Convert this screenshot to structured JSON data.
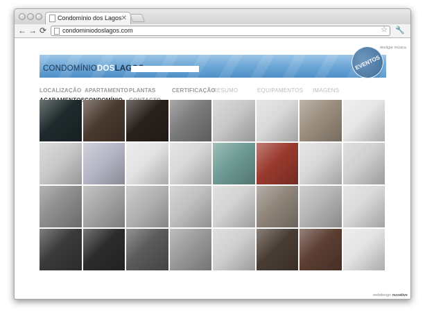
{
  "browser": {
    "tab_title": "Condomínio dos Lagos",
    "tab_close": "✕",
    "url": "condominiodoslagos.com",
    "back": "←",
    "forward": "→",
    "reload": "⟳",
    "star": "☆",
    "wrench": "🔧"
  },
  "page": {
    "music_link": "desligar música",
    "brand": {
      "part1": "CONDOMÍNIO",
      "part2": "DOS",
      "part3": "LAGOS"
    },
    "eventos_label": "EVENTOS",
    "nav_main": [
      {
        "label": "LOCALIZAÇÃO"
      },
      {
        "label": "APARTAMENTO"
      },
      {
        "label": "PLANTAS"
      },
      {
        "label": "CERTIFICAÇÃO"
      },
      {
        "label": "ACABAMENTOS"
      },
      {
        "label": "CONDOMÍNIO"
      },
      {
        "label": "CONTACTO"
      }
    ],
    "nav_sub": [
      {
        "label": "RESUMO"
      },
      {
        "label": "EQUIPAMENTOS"
      },
      {
        "label": "IMAGENS"
      }
    ],
    "footer": {
      "webdesign": "webdesign",
      "brand": "nuvative"
    },
    "gallery": [
      {
        "name": "ceramic-hob-photo",
        "bg": "#1e2a2c"
      },
      {
        "name": "microwave-photo",
        "bg": "#4a3a2f"
      },
      {
        "name": "oven-photo",
        "bg": "#2a211c"
      },
      {
        "name": "range-hood-photo",
        "bg": "#7b7b7b"
      },
      {
        "name": "kitchen-sink-photo",
        "bg": "#c8c8c8"
      },
      {
        "name": "water-heater-photo",
        "bg": "#d9d9d9"
      },
      {
        "name": "steel-sink-photo",
        "bg": "#9b8e7e"
      },
      {
        "name": "faucet-photo",
        "bg": "#e6e6e6"
      },
      {
        "name": "washing-machine-photo",
        "bg": "#c9c9c9"
      },
      {
        "name": "boiler-panel-photo",
        "bg": "#b7b7c7"
      },
      {
        "name": "alarm-keypad-photo",
        "bg": "#e3e3e3"
      },
      {
        "name": "intercom-photo",
        "bg": "#d7d7d7"
      },
      {
        "name": "washbasin-photo",
        "bg": "#6e9c95"
      },
      {
        "name": "pedestal-sink-photo",
        "bg": "#9a3a2e"
      },
      {
        "name": "bath-tap-photo",
        "bg": "#d8d8d8"
      },
      {
        "name": "wall-basin-photo",
        "bg": "#cfcfcf"
      },
      {
        "name": "shower-mixer-photo",
        "bg": "#8d8d8d"
      },
      {
        "name": "towel-radiator-photo",
        "bg": "#a5a5a5"
      },
      {
        "name": "bathtub-photo",
        "bg": "#b3b3b3"
      },
      {
        "name": "toilet-photo",
        "bg": "#c0c0c0"
      },
      {
        "name": "bidet-photo",
        "bg": "#d2d2d2"
      },
      {
        "name": "blinds-kitchen-photo",
        "bg": "#8f857a"
      },
      {
        "name": "marble-counter-photo",
        "bg": "#b5b5b5"
      },
      {
        "name": "bath-spout-photo",
        "bg": "#d9d9d9"
      },
      {
        "name": "window-blind-photo",
        "bg": "#3a3a3a"
      },
      {
        "name": "shutter-photo",
        "bg": "#2c2c2c"
      },
      {
        "name": "roller-blind-photo",
        "bg": "#5a5a5a"
      },
      {
        "name": "window-slats-photo",
        "bg": "#9a9a9a"
      },
      {
        "name": "air-vent-photo",
        "bg": "#d0d0d0"
      },
      {
        "name": "dishwasher-photo",
        "bg": "#4a3e34"
      },
      {
        "name": "fridge-photo",
        "bg": "#5c3e32"
      },
      {
        "name": "door-handle-photo",
        "bg": "#e4e4e4"
      }
    ]
  }
}
